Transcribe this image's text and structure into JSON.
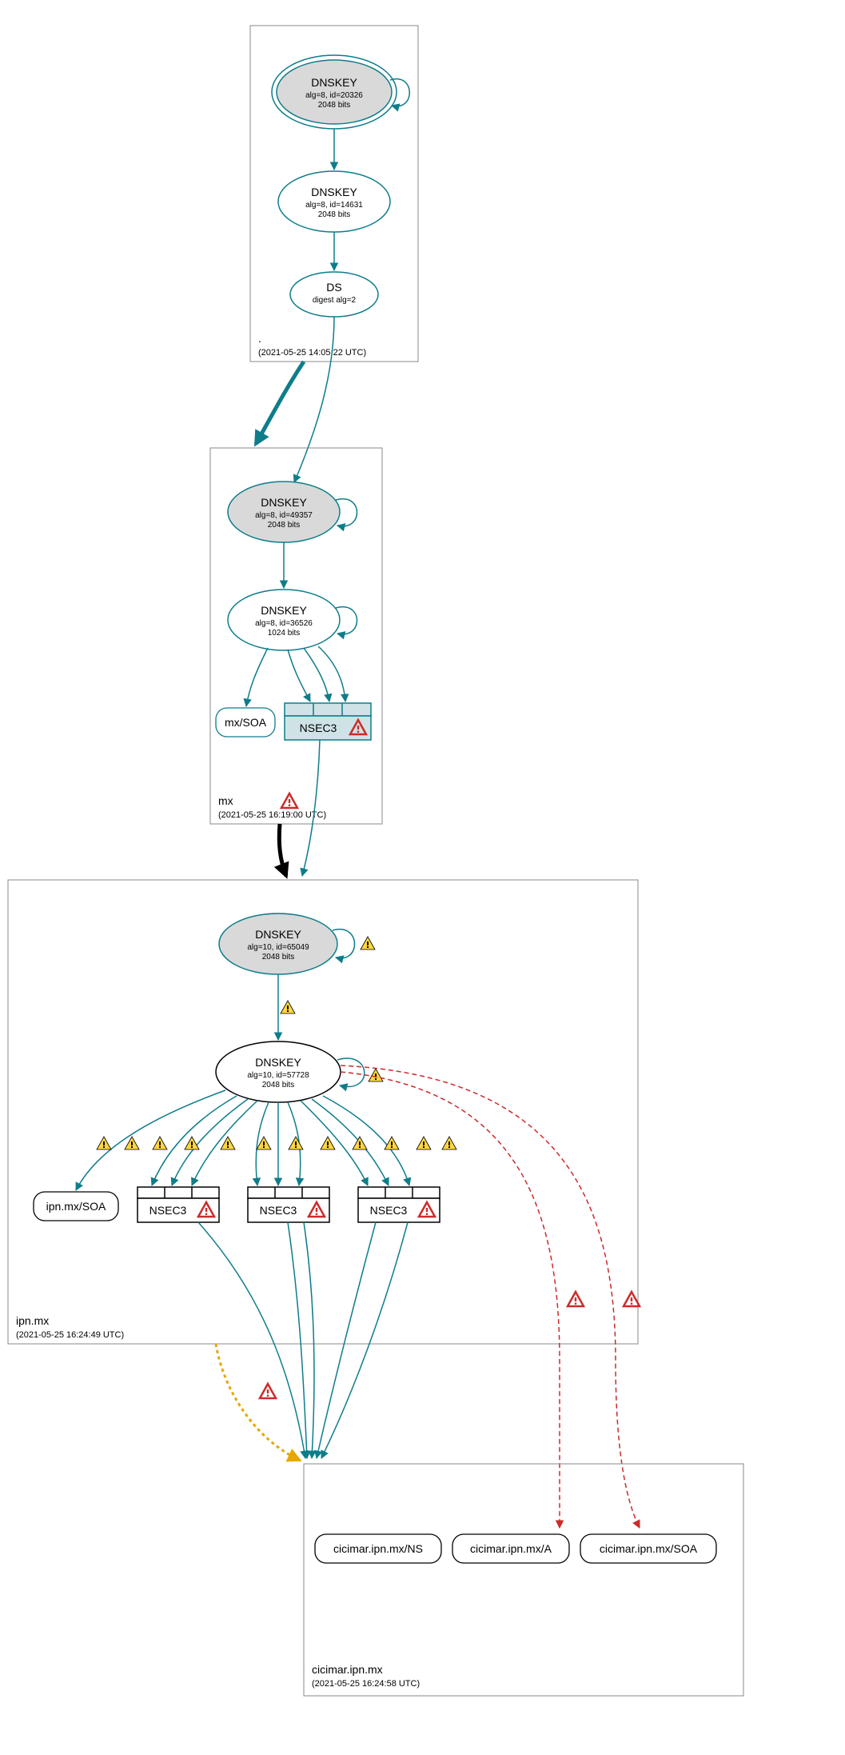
{
  "zones": {
    "root": {
      "name": ".",
      "timestamp": "(2021-05-25 14:05:22 UTC)"
    },
    "mx": {
      "name": "mx",
      "timestamp": "(2021-05-25 16:19:00 UTC)"
    },
    "ipn": {
      "name": "ipn.mx",
      "timestamp": "(2021-05-25 16:24:49 UTC)"
    },
    "cicimar": {
      "name": "cicimar.ipn.mx",
      "timestamp": "(2021-05-25 16:24:58 UTC)"
    }
  },
  "nodes": {
    "root_ksk": {
      "title": "DNSKEY",
      "l1": "alg=8, id=20326",
      "l2": "2048 bits"
    },
    "root_zsk": {
      "title": "DNSKEY",
      "l1": "alg=8, id=14631",
      "l2": "2048 bits"
    },
    "root_ds": {
      "title": "DS",
      "l1": "digest alg=2"
    },
    "mx_ksk": {
      "title": "DNSKEY",
      "l1": "alg=8, id=49357",
      "l2": "2048 bits"
    },
    "mx_zsk": {
      "title": "DNSKEY",
      "l1": "alg=8, id=36526",
      "l2": "1024 bits"
    },
    "mx_soa": {
      "title": "mx/SOA"
    },
    "mx_nsec3": {
      "title": "NSEC3"
    },
    "ipn_ksk": {
      "title": "DNSKEY",
      "l1": "alg=10, id=65049",
      "l2": "2048 bits"
    },
    "ipn_zsk": {
      "title": "DNSKEY",
      "l1": "alg=10, id=57728",
      "l2": "2048 bits"
    },
    "ipn_soa": {
      "title": "ipn.mx/SOA"
    },
    "ipn_nsec3_a": {
      "title": "NSEC3"
    },
    "ipn_nsec3_b": {
      "title": "NSEC3"
    },
    "ipn_nsec3_c": {
      "title": "NSEC3"
    },
    "cic_ns": {
      "title": "cicimar.ipn.mx/NS"
    },
    "cic_a": {
      "title": "cicimar.ipn.mx/A"
    },
    "cic_soa": {
      "title": "cicimar.ipn.mx/SOA"
    }
  },
  "colors": {
    "teal": "#0d7d8a",
    "ksk_fill": "#d9d9d9",
    "warn_yellow": "#ffd63f",
    "warn_red": "#cc2b2b",
    "orange": "#e6a700"
  }
}
